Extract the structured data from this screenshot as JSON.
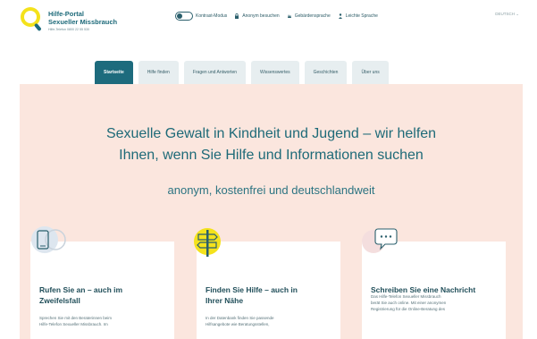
{
  "header": {
    "logo_title_line1": "Hilfe-Portal",
    "logo_title_line2": "Sexueller Missbrauch",
    "logo_subtitle": "Hilfe-Telefon 0800 22 55 530",
    "utility": {
      "contrast_label": "Kontrast-Modus",
      "anonymous_label": "Anonym besuchen",
      "sign_language_label": "Gebärdensprache",
      "easy_language_label": "Leichte Sprache"
    },
    "language": "DEUTSCH ⌄"
  },
  "tabs": [
    {
      "label": "Startseite"
    },
    {
      "label": "Hilfe finden"
    },
    {
      "label": "Fragen und Antworten"
    },
    {
      "label": "Wissenswertes"
    },
    {
      "label": "Geschichten"
    },
    {
      "label": "Über uns"
    }
  ],
  "hero": {
    "title_line1": "Sexuelle Gewalt in Kindheit und Jugend – wir helfen",
    "title_line2": "Ihnen, wenn Sie Hilfe und Informationen suchen",
    "subtitle": "anonym, kostenfrei und deutschlandweit"
  },
  "cards": [
    {
      "icon": "phone-icon",
      "title_line1": "Rufen Sie an – auch im",
      "title_line2": "Zweifelsfall",
      "text_line1": "Sprechen Sie mit den Beraterinnen beim",
      "text_line2": "Hilfe-Telefon Sexueller Missbrauch. Im"
    },
    {
      "icon": "signpost-icon",
      "title_line1": "Finden Sie Hilfe – auch in",
      "title_line2": "Ihrer Nähe",
      "text_line1": "In der Datenbank finden Sie passende",
      "text_line2": "Hilfsangebote wie Beratungsstellen,"
    },
    {
      "icon": "chat-icon",
      "title_line1": "Schreiben Sie eine Nachricht",
      "title_line2": "",
      "text_line1": "Das Hilfe-Telefon Sexueller Missbrauch",
      "text_line2": "berät Sie auch online. Mit einer anonymen",
      "text_line3": "Registrierung für die Online-Beratung des"
    }
  ],
  "colors": {
    "brand_teal": "#1d6b7d",
    "hero_bg": "#fbe6de",
    "logo_yellow": "#f4e21c",
    "tab_bg": "#e7eef0"
  }
}
